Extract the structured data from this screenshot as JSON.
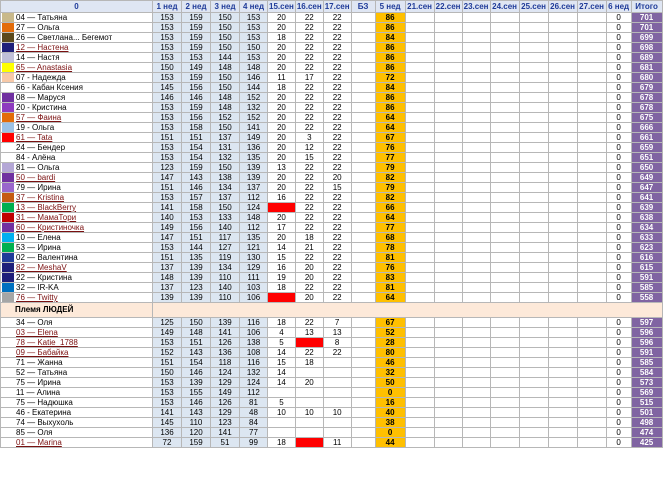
{
  "headers": [
    "0",
    "1 нед",
    "2 нед",
    "3 нед",
    "4 нед",
    "15.сен",
    "16.сен",
    "17.сен",
    "БЗ",
    "5 нед",
    "21.сен",
    "22.сен",
    "23.сен",
    "24.сен",
    "25.сен",
    "26.сен",
    "27.сен",
    "6 нед",
    "Итого"
  ],
  "section_label": "Племя ЛЮДЕЙ",
  "rows": [
    {
      "name": "04 — Татьяна",
      "color": "#c9b98a",
      "w1": "153",
      "w2": "159",
      "w3": "150",
      "w4": "153",
      "d15": "20",
      "d16": "22",
      "d17": "22",
      "w5": "86",
      "w6": "0",
      "total": "701"
    },
    {
      "name": "27 — Ольга",
      "color": "#e36c09",
      "w1": "153",
      "w2": "159",
      "w3": "150",
      "w4": "153",
      "d15": "20",
      "d16": "22",
      "d17": "22",
      "w5": "86",
      "w6": "0",
      "total": "701"
    },
    {
      "name": "26 — Светлана... Бегемот",
      "color": "#5c4a1c",
      "w1": "153",
      "w2": "159",
      "w3": "150",
      "w4": "153",
      "d15": "18",
      "d16": "22",
      "d17": "22",
      "w5": "84",
      "w6": "0",
      "total": "699"
    },
    {
      "name": "12 — Настена",
      "color": "#1f1f7a",
      "u": true,
      "w1": "153",
      "w2": "159",
      "w3": "150",
      "w4": "150",
      "d15": "20",
      "d16": "22",
      "d17": "22",
      "w5": "86",
      "w6": "0",
      "total": "698"
    },
    {
      "name": "14 — Настя",
      "color": "#c0c0d8",
      "w1": "153",
      "w2": "153",
      "w3": "144",
      "w4": "153",
      "d15": "20",
      "d16": "22",
      "d17": "22",
      "w5": "86",
      "w6": "0",
      "total": "689"
    },
    {
      "name": "65 — Anastasia",
      "color": "#ffff00",
      "u": true,
      "w1": "150",
      "w2": "149",
      "w3": "148",
      "w4": "148",
      "d15": "20",
      "d16": "22",
      "d17": "22",
      "w5": "86",
      "w6": "0",
      "total": "681"
    },
    {
      "name": "07 - Надежда",
      "color": "#f7c9a8",
      "w1": "153",
      "w2": "159",
      "w3": "150",
      "w4": "146",
      "d15": "11",
      "d16": "17",
      "d17": "22",
      "w5": "72",
      "w6": "0",
      "total": "680"
    },
    {
      "name": "66 - Кабан Ксения",
      "color": "#ffffff",
      "w1": "145",
      "w2": "156",
      "w3": "150",
      "w4": "144",
      "d15": "18",
      "d16": "22",
      "d17": "22",
      "w5": "84",
      "w6": "0",
      "total": "679"
    },
    {
      "name": "08 — Маруся",
      "color": "#7030a0",
      "w1": "146",
      "w2": "146",
      "w3": "148",
      "w4": "152",
      "d15": "20",
      "d16": "22",
      "d17": "22",
      "w5": "86",
      "w6": "0",
      "total": "678"
    },
    {
      "name": "20 - Кристина",
      "color": "#8e3bbf",
      "w1": "153",
      "w2": "159",
      "w3": "148",
      "w4": "132",
      "d15": "20",
      "d16": "22",
      "d17": "22",
      "w5": "86",
      "w6": "0",
      "total": "678"
    },
    {
      "name": "57 — Фаина",
      "color": "#e36c09",
      "u": true,
      "w1": "153",
      "w2": "156",
      "w3": "152",
      "w4": "152",
      "d15": "20",
      "d16": "22",
      "d17": "22",
      "w5": "64",
      "w6": "0",
      "total": "675"
    },
    {
      "name": "19 - Ольга",
      "color": "#9bc2e6",
      "w1": "153",
      "w2": "158",
      "w3": "150",
      "w4": "141",
      "d15": "20",
      "d16": "22",
      "d17": "22",
      "w5": "64",
      "w6": "0",
      "total": "666"
    },
    {
      "name": "61 — Tata",
      "color": "#ff0000",
      "u": true,
      "w1": "151",
      "w2": "151",
      "w3": "137",
      "w4": "149",
      "d15": "20",
      "d16": "3",
      "d17": "22",
      "w5": "67",
      "w6": "0",
      "total": "661"
    },
    {
      "name": "24 — Бендер",
      "color": "#ffffff",
      "w1": "153",
      "w2": "154",
      "w3": "131",
      "w4": "136",
      "d15": "20",
      "d16": "12",
      "d17": "22",
      "w5": "76",
      "w6": "0",
      "total": "659"
    },
    {
      "name": "84 - Алёна",
      "color": "#ffffff",
      "w1": "153",
      "w2": "154",
      "w3": "132",
      "w4": "135",
      "d15": "20",
      "d16": "15",
      "d17": "22",
      "w5": "77",
      "w6": "0",
      "total": "651"
    },
    {
      "name": "81 — Ольга",
      "color": "#b4a7d6",
      "w1": "123",
      "w2": "159",
      "w3": "150",
      "w4": "139",
      "d15": "13",
      "d16": "22",
      "d17": "22",
      "w5": "79",
      "w6": "0",
      "total": "650"
    },
    {
      "name": "50 — bardi",
      "color": "#7030a0",
      "u": true,
      "w1": "147",
      "w2": "143",
      "w3": "138",
      "w4": "139",
      "d15": "20",
      "d16": "22",
      "d17": "20",
      "w5": "82",
      "w6": "0",
      "total": "649"
    },
    {
      "name": "79 — Ирина",
      "color": "#9966cc",
      "w1": "151",
      "w2": "146",
      "w3": "134",
      "w4": "137",
      "d15": "20",
      "d16": "22",
      "d17": "15",
      "w5": "79",
      "w6": "0",
      "total": "647"
    },
    {
      "name": "37 — Kristina",
      "color": "#c55a11",
      "u": true,
      "w1": "153",
      "w2": "157",
      "w3": "137",
      "w4": "112",
      "d15": "16",
      "d16": "22",
      "d17": "22",
      "w5": "82",
      "w6": "0",
      "total": "641"
    },
    {
      "name": "13 — BlackBerry",
      "color": "#00b050",
      "u": true,
      "w1": "141",
      "w2": "158",
      "w3": "150",
      "w4": "124",
      "d15": "",
      "d16": "22",
      "d17": "22",
      "w5": "66",
      "w6": "0",
      "total": "639",
      "red15": true
    },
    {
      "name": "31 — МамаТори",
      "color": "#c00000",
      "u": true,
      "w1": "140",
      "w2": "153",
      "w3": "133",
      "w4": "148",
      "d15": "20",
      "d16": "22",
      "d17": "22",
      "w5": "64",
      "w6": "0",
      "total": "638"
    },
    {
      "name": "60 — Кристиночка",
      "color": "#7030a0",
      "u": true,
      "w1": "149",
      "w2": "156",
      "w3": "140",
      "w4": "112",
      "d15": "17",
      "d16": "22",
      "d17": "22",
      "w5": "77",
      "w6": "0",
      "total": "634"
    },
    {
      "name": "10 — Елена",
      "color": "#00b0f0",
      "w1": "147",
      "w2": "151",
      "w3": "117",
      "w4": "135",
      "d15": "20",
      "d16": "18",
      "d17": "22",
      "w5": "68",
      "w6": "0",
      "total": "633"
    },
    {
      "name": "53 — Ирина",
      "color": "#00b050",
      "w1": "153",
      "w2": "144",
      "w3": "127",
      "w4": "121",
      "d15": "14",
      "d16": "21",
      "d17": "22",
      "w5": "78",
      "w6": "0",
      "total": "623"
    },
    {
      "name": "02 — Валентина",
      "color": "#1f3b99",
      "w1": "151",
      "w2": "135",
      "w3": "119",
      "w4": "130",
      "d15": "15",
      "d16": "22",
      "d17": "22",
      "w5": "81",
      "w6": "0",
      "total": "616"
    },
    {
      "name": "82 — MeshaV",
      "color": "#1f1f7a",
      "u": true,
      "w1": "137",
      "w2": "139",
      "w3": "134",
      "w4": "129",
      "d15": "16",
      "d16": "20",
      "d17": "22",
      "w5": "76",
      "w6": "0",
      "total": "615"
    },
    {
      "name": "22 — Кристина",
      "color": "#1f1f7a",
      "w1": "148",
      "w2": "139",
      "w3": "110",
      "w4": "111",
      "d15": "19",
      "d16": "20",
      "d17": "22",
      "w5": "83",
      "w6": "0",
      "total": "591"
    },
    {
      "name": "32 — IR-KA",
      "color": "#0070c0",
      "w1": "137",
      "w2": "123",
      "w3": "140",
      "w4": "103",
      "d15": "18",
      "d16": "22",
      "d17": "22",
      "w5": "81",
      "w6": "0",
      "total": "585"
    },
    {
      "name": "76 — Twitty",
      "color": "#a6a6a6",
      "u": true,
      "w1": "139",
      "w2": "139",
      "w3": "110",
      "w4": "106",
      "d15": "",
      "d16": "20",
      "d17": "22",
      "w5": "64",
      "w6": "0",
      "total": "558",
      "red15": true
    }
  ],
  "rows2": [
    {
      "name": "34 — Оля",
      "color": "#ffffff",
      "w1": "125",
      "w2": "150",
      "w3": "139",
      "w4": "116",
      "d15": "18",
      "d16": "22",
      "d17": "7",
      "w5": "67",
      "w6": "0",
      "total": "597"
    },
    {
      "name": "03 — Elena",
      "color": "#ffffff",
      "u": true,
      "w1": "149",
      "w2": "148",
      "w3": "141",
      "w4": "106",
      "d15": "4",
      "d16": "13",
      "d17": "13",
      "w5": "52",
      "w6": "0",
      "total": "596"
    },
    {
      "name": "78 — Katie_1788",
      "color": "#ffffff",
      "u": true,
      "w1": "153",
      "w2": "151",
      "w3": "126",
      "w4": "138",
      "d15": "5",
      "d16": "",
      "d17": "8",
      "w5": "28",
      "w6": "0",
      "total": "596",
      "red16": true
    },
    {
      "name": "09 — Бабайка",
      "color": "#ffffff",
      "u": true,
      "w1": "152",
      "w2": "143",
      "w3": "136",
      "w4": "108",
      "d15": "14",
      "d16": "22",
      "d17": "22",
      "w5": "80",
      "w6": "0",
      "total": "591"
    },
    {
      "name": "71 — Жанна",
      "color": "#ffffff",
      "w1": "151",
      "w2": "154",
      "w3": "118",
      "w4": "116",
      "d15": "15",
      "d16": "18",
      "d17": "",
      "w5": "46",
      "w6": "0",
      "total": "585"
    },
    {
      "name": "52 — Татьяна",
      "color": "#ffffff",
      "w1": "150",
      "w2": "146",
      "w3": "124",
      "w4": "132",
      "d15": "14",
      "d16": "",
      "d17": "",
      "w5": "32",
      "w6": "0",
      "total": "584"
    },
    {
      "name": "75 — Ирина",
      "color": "#ffffff",
      "w1": "153",
      "w2": "139",
      "w3": "129",
      "w4": "124",
      "d15": "14",
      "d16": "20",
      "d17": "",
      "w5": "50",
      "w6": "0",
      "total": "573"
    },
    {
      "name": "11 — Алина",
      "color": "#ffffff",
      "w1": "153",
      "w2": "155",
      "w3": "149",
      "w4": "112",
      "d15": "",
      "d16": "",
      "d17": "",
      "w5": "0",
      "w6": "0",
      "total": "569"
    },
    {
      "name": "75 — Надюшка",
      "color": "#ffffff",
      "w1": "153",
      "w2": "146",
      "w3": "126",
      "w4": "81",
      "d15": "5",
      "d16": "",
      "d17": "",
      "w5": "16",
      "w6": "0",
      "total": "515"
    },
    {
      "name": "46 - Екатерина",
      "color": "#ffffff",
      "w1": "141",
      "w2": "143",
      "w3": "129",
      "w4": "48",
      "d15": "10",
      "d16": "10",
      "d17": "10",
      "w5": "40",
      "w6": "0",
      "total": "501"
    },
    {
      "name": "74 — Выхухоль",
      "color": "#ffffff",
      "w1": "145",
      "w2": "110",
      "w3": "123",
      "w4": "84",
      "d15": "",
      "d16": "",
      "d17": "",
      "w5": "38",
      "w6": "0",
      "total": "498"
    },
    {
      "name": "85 — Оля",
      "color": "#ffffff",
      "w1": "136",
      "w2": "120",
      "w3": "141",
      "w4": "77",
      "d15": "",
      "d16": "",
      "d17": "",
      "w5": "0",
      "w6": "0",
      "total": "474"
    },
    {
      "name": "01 — Marina",
      "color": "#ffffff",
      "u": true,
      "w1": "72",
      "w2": "159",
      "w3": "51",
      "w4": "99",
      "d15": "18",
      "d16": "",
      "d17": "11",
      "w5": "44",
      "w6": "0",
      "total": "425",
      "red16": true
    }
  ]
}
